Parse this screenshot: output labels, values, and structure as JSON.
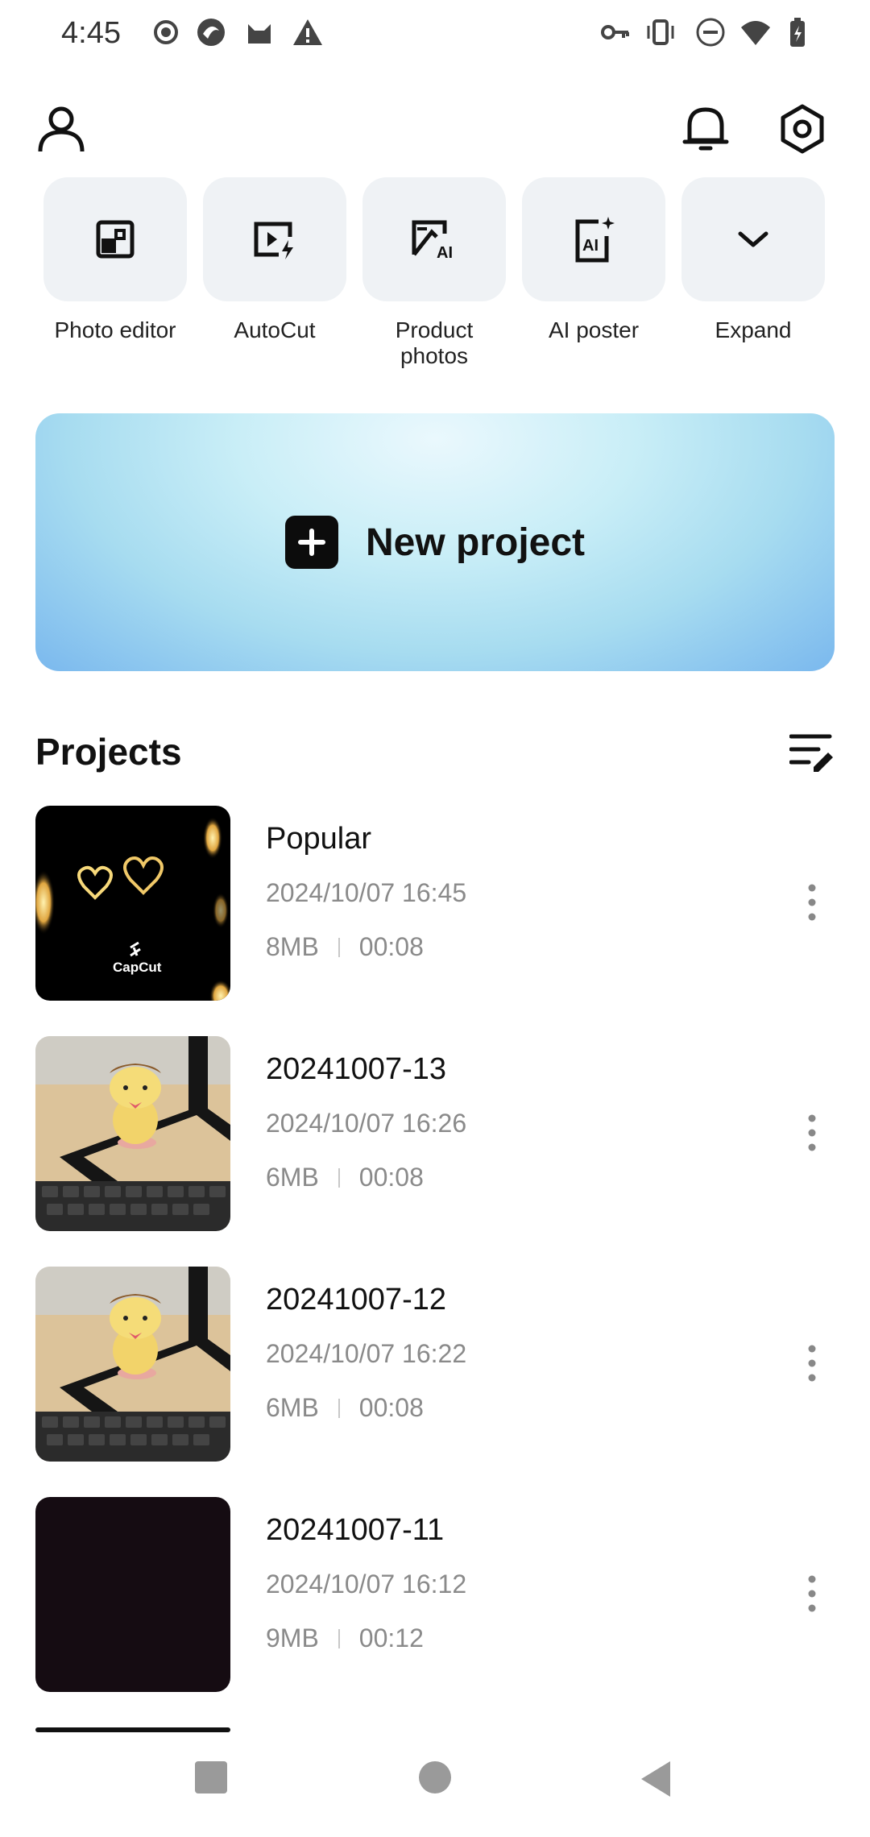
{
  "status_bar": {
    "time": "4:45",
    "left_icons": [
      "record-icon",
      "app-icon",
      "cat-icon",
      "warning-icon"
    ],
    "right_icons": [
      "key-icon",
      "vibrate-icon",
      "dnd-icon",
      "wifi-icon",
      "battery-icon"
    ]
  },
  "header": {
    "profile_icon": "person-icon",
    "notification_icon": "bell-icon",
    "settings_icon": "hexagon-settings-icon"
  },
  "tools": [
    {
      "label": "Photo editor",
      "icon": "photo-editor-icon"
    },
    {
      "label": "AutoCut",
      "icon": "autocut-icon"
    },
    {
      "label": "Product\nphotos",
      "icon": "product-photos-icon"
    },
    {
      "label": "AI poster",
      "icon": "ai-poster-icon"
    },
    {
      "label": "Expand",
      "icon": "chevron-down-icon"
    }
  ],
  "banner": {
    "label": "New project"
  },
  "projects": {
    "title": "Projects",
    "items": [
      {
        "title": "Popular",
        "date": "2024/10/07 16:45",
        "size": "8MB",
        "duration": "00:08",
        "thumb": "hearts"
      },
      {
        "title": "20241007-13",
        "date": "2024/10/07 16:26",
        "size": "6MB",
        "duration": "00:08",
        "thumb": "desk"
      },
      {
        "title": "20241007-12",
        "date": "2024/10/07 16:22",
        "size": "6MB",
        "duration": "00:08",
        "thumb": "desk"
      },
      {
        "title": "20241007-11",
        "date": "2024/10/07 16:12",
        "size": "9MB",
        "duration": "00:12",
        "thumb": "dark"
      }
    ]
  },
  "thumb_logo": "CapCut",
  "nav": [
    "recents-square-icon",
    "home-circle-icon",
    "back-triangle-icon"
  ]
}
